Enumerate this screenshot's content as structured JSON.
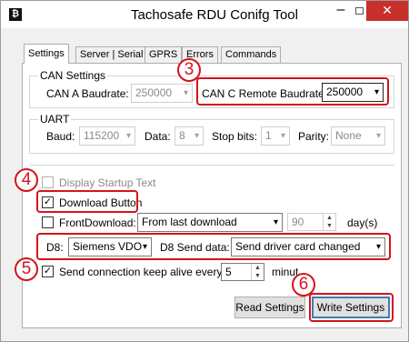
{
  "window": {
    "title": "Tachosafe  RDU Conifg Tool",
    "app_icon": "tachosafe-app-icon",
    "minimize_glyph": "–",
    "close_glyph": "✕"
  },
  "tabs": [
    {
      "label": "Settings",
      "active": true
    },
    {
      "label": "Server | Serial"
    },
    {
      "label": "GPRS"
    },
    {
      "label": "Errors"
    },
    {
      "label": "Commands"
    }
  ],
  "can": {
    "group_title": "CAN Settings",
    "a_baud_label": "CAN A Baudrate:",
    "a_baud_value": "250000",
    "c_baud_label": "CAN C Remote Baudrate :",
    "c_baud_value": "250000"
  },
  "uart": {
    "group_title": "UART",
    "baud_label": "Baud:",
    "baud_value": "115200",
    "data_label": "Data:",
    "data_value": "8",
    "stop_label": "Stop bits:",
    "stop_value": "1",
    "parity_label": "Parity:",
    "parity_value": "None"
  },
  "options": {
    "display_startup_label": "Display Startup Text",
    "download_button_label": "Download Button",
    "front_download_label": "FrontDownload:",
    "front_download_value": "From last download",
    "days_value": "90",
    "days_unit": "day(s)",
    "d8_label": "D8:",
    "d8_value": "Siemens VDO",
    "d8_send_label": "D8 Send data:",
    "d8_send_value": "Send driver card changed",
    "keepalive_label": "Send connection keep alive every:",
    "keepalive_value": "5",
    "keepalive_unit": "minut"
  },
  "buttons": {
    "read_settings": "Read Settings",
    "write_settings": "Write Settings"
  },
  "annotations": {
    "marker_3": "3",
    "marker_4": "4",
    "marker_5": "5",
    "marker_6": "6",
    "highlight_color": "#d3141c"
  },
  "glyphs": {
    "dropdown": "▾",
    "check": "✓",
    "spin_up": "▲",
    "spin_down": "▼"
  }
}
